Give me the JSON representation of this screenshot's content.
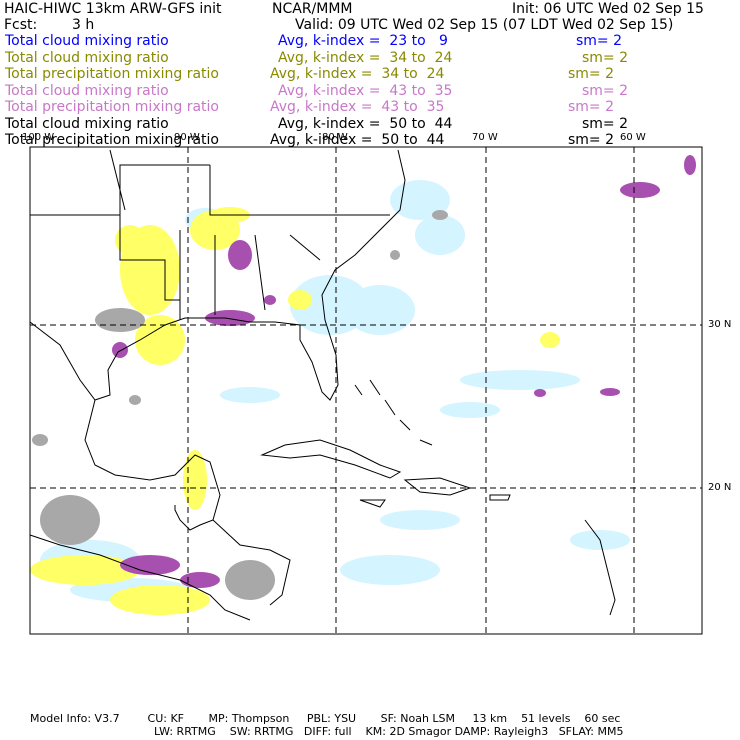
{
  "header": {
    "title": "HAIC-HIWC 13km ARW-GFS init",
    "org": "NCAR/MMM",
    "init": "Init: 06 UTC Wed 02 Sep 15",
    "fcst_label": "Fcst:",
    "fcst_value": "3 h",
    "valid": "Valid: 09 UTC Wed 02 Sep 15 (07 LDT Wed 02 Sep 15)"
  },
  "legend": [
    {
      "field": "Total cloud mixing ratio",
      "range": "Avg, k-index =  23 to   9",
      "sm": "sm= 2",
      "color": "blue"
    },
    {
      "field": "Total cloud mixing ratio",
      "range": "Avg, k-index =  34 to  24",
      "sm": "sm= 2",
      "color": "olive"
    },
    {
      "field": "Total precipitation mixing ratio",
      "range": "Avg, k-index =  34 to  24",
      "sm": "sm= 2",
      "color": "olive"
    },
    {
      "field": "Total cloud mixing ratio",
      "range": "Avg, k-index =  43 to  35",
      "sm": "sm= 2",
      "color": "pink"
    },
    {
      "field": "Total precipitation mixing ratio",
      "range": "Avg, k-index =  43 to  35",
      "sm": "sm= 2",
      "color": "pink"
    },
    {
      "field": "Total cloud mixing ratio",
      "range": "Avg, k-index =  50 to  44",
      "sm": "sm= 2",
      "color": "black"
    },
    {
      "field": "Total precipitation mixing ratio",
      "range": "Avg, k-index =  50 to  44",
      "sm": "sm= 2",
      "color": "black"
    }
  ],
  "map": {
    "lon_labels": [
      "100 W",
      "90 W",
      "80 W",
      "70 W",
      "60 W"
    ],
    "lat_labels": [
      "30 N",
      "20 N"
    ],
    "colors": {
      "blue_fill": "#d4f4ff",
      "olive_fill": "#ffff66",
      "pink_fill": "#a850b0",
      "black_fill": "#a8a8a8"
    }
  },
  "footer": {
    "line1": "Model Info: V3.7        CU: KF       MP: Thompson     PBL: YSU       SF: Noah LSM     13 km    51 levels    60 sec",
    "line2": "LW: RRTMG    SW: RRTMG   DIFF: full    KM: 2D Smagor DAMP: Rayleigh3   SFLAY: MM5"
  }
}
